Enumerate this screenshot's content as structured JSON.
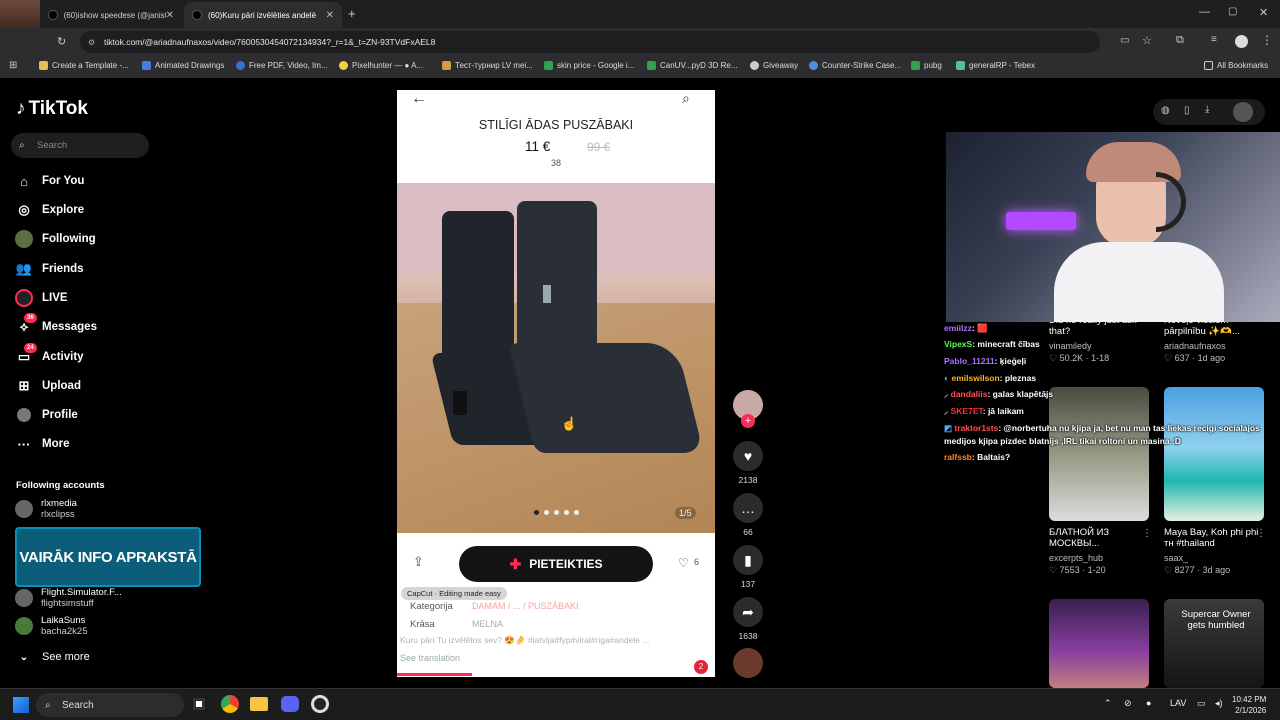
{
  "tabs": [
    {
      "title": "(60)ishow speedɐsɐ (@janistil",
      "active": false
    },
    {
      "title": "(60)Kuru pāri izvēlēties andelē",
      "active": true
    }
  ],
  "address_url": "tiktok.com/@ariadnaufnaxos/video/7600530454072134934?_r=1&_t=ZN-93TVdFxAEL8",
  "bookmarks": [
    "Create a Template -...",
    "Animated Drawings",
    "Free PDF, Video, Im...",
    "Pixelhunter — ● A...",
    "Тест-турнир LV mei...",
    "skin price - Google i...",
    "CanUV...pyD 3D Re...",
    "Giveaway",
    "Counter-Strike Case...",
    "pubg",
    "generalRP - Tebex"
  ],
  "all_bookmarks": "All Bookmarks",
  "tiktok": {
    "logo": "TikTok",
    "search_placeholder": "Search",
    "nav": [
      {
        "label": "For You",
        "icon": "home-icon"
      },
      {
        "label": "Explore",
        "icon": "compass-icon"
      },
      {
        "label": "Following",
        "icon": "following-icon"
      },
      {
        "label": "Friends",
        "icon": "friends-icon"
      },
      {
        "label": "LIVE",
        "icon": "live-icon"
      },
      {
        "label": "Messages",
        "icon": "messages-icon",
        "badge": "36"
      },
      {
        "label": "Activity",
        "icon": "activity-icon",
        "badge": "24"
      },
      {
        "label": "Upload",
        "icon": "upload-icon"
      },
      {
        "label": "Profile",
        "icon": "profile-icon"
      },
      {
        "label": "More",
        "icon": "more-icon"
      }
    ],
    "following_accounts_title": "Following accounts",
    "accounts": [
      {
        "name": "rlxmedia",
        "handle": "rlxclipss"
      },
      {
        "name": "Flight.Simulator.F...",
        "handle": "flightsimstuff"
      },
      {
        "name": "LaikaSuns",
        "handle": "bacha2k25"
      }
    ],
    "see_more": "See more",
    "promo_text": "VAIRĀK INFO APRAKSTĀ"
  },
  "video": {
    "product_title": "STILĪGI ĀDAS PUSZĀBAKI",
    "price": "11 €",
    "old_price": "99 €",
    "size": "38",
    "photo_counter": "1/5",
    "apply_button": "PIETEIKTIES",
    "likes_small": "6",
    "capcut": "CapCut · Editing made easy",
    "category_label": "Kategorija",
    "category_value": "DAMAM / ... / PUSZĀBAKI",
    "color_label": "Krāsa",
    "color_value": "MELNA",
    "caption": "Kuru pāri Tu izvēlētos sev? 😍🤌 #latvija#fyp#viral#riga#andele ...",
    "see_translation": "See translation",
    "notification_badge": "2"
  },
  "actions": [
    {
      "icon": "heart-icon",
      "count": "2138"
    },
    {
      "icon": "comment-icon",
      "count": "66"
    },
    {
      "icon": "bookmark-icon",
      "count": "137"
    },
    {
      "icon": "share-icon",
      "count": "1638"
    }
  ],
  "chat": [
    {
      "user": "emiilzz",
      "msg": ": 🟥",
      "color": "#b070ff"
    },
    {
      "user": "VipexS",
      "msg": ": minecraft čības",
      "color": "#50ff50"
    },
    {
      "user": "Pablo_11211",
      "msg": ": ķieģeļi",
      "color": "#b070ff"
    },
    {
      "user": "emilswilson",
      "msg": ": pleznas",
      "color": "#ffb020"
    },
    {
      "user": "dandaliis",
      "msg": ": galas klapētājs",
      "color": "#ff5050"
    },
    {
      "user": "SKE7ET",
      "msg": ": jā laikam",
      "color": "#ff3030"
    },
    {
      "user": "traktor1sts",
      "msg": ": @norbertuha nu kjipa ja, bet nu man tas liekas recigi socialajos medijos kjipa pizdec blatnijs ,IRL tikai roltoni un masina :D",
      "color": "#ff5050"
    },
    {
      "user": "ralfssb",
      "msg": ": Baltais?",
      "color": "#ff8a30"
    }
  ],
  "recommended": [
    {
      "title": "Did he really just ask that?",
      "author": "vinamiledy",
      "views": "50.2K",
      "date": "1-18"
    },
    {
      "title": "Noveļo viesiem pārpilnību ✨🫶...",
      "author": "ariadnaufnaxos",
      "views": "637",
      "date": "1d ago"
    },
    {
      "title": "БЛАТНОЙ ИЗ МОСКВЫ...",
      "author": "excerpts_hub",
      "views": "7553",
      "date": "1-20"
    },
    {
      "title": "Maya Bay, Koh phi phi ᴛʜ #thailand",
      "author": "saax_",
      "views": "8277",
      "date": "3d ago"
    }
  ],
  "thumb_overlays": [
    "Supercar Owner gets humbled"
  ],
  "taskbar": {
    "search": "Search",
    "lang": "LAV",
    "time": "10:42 PM",
    "date": "2/1/2026"
  }
}
